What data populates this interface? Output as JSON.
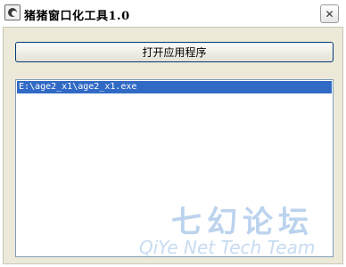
{
  "window": {
    "title": "猪猪窗口化工具1.0",
    "icon": "pig-app-icon",
    "close_glyph": "✕"
  },
  "toolbar": {
    "open_app_label": "打开应用程序"
  },
  "list": {
    "items": [
      "E:\\age2_x1\\age2_x1.exe"
    ],
    "selected_index": 0
  },
  "watermark": {
    "cn": "七幻论坛",
    "en": "QiYe Net Tech Team"
  },
  "colors": {
    "selection": "#316ac5",
    "client_bg": "#ece9d8",
    "watermark": "#bcd3ee"
  }
}
